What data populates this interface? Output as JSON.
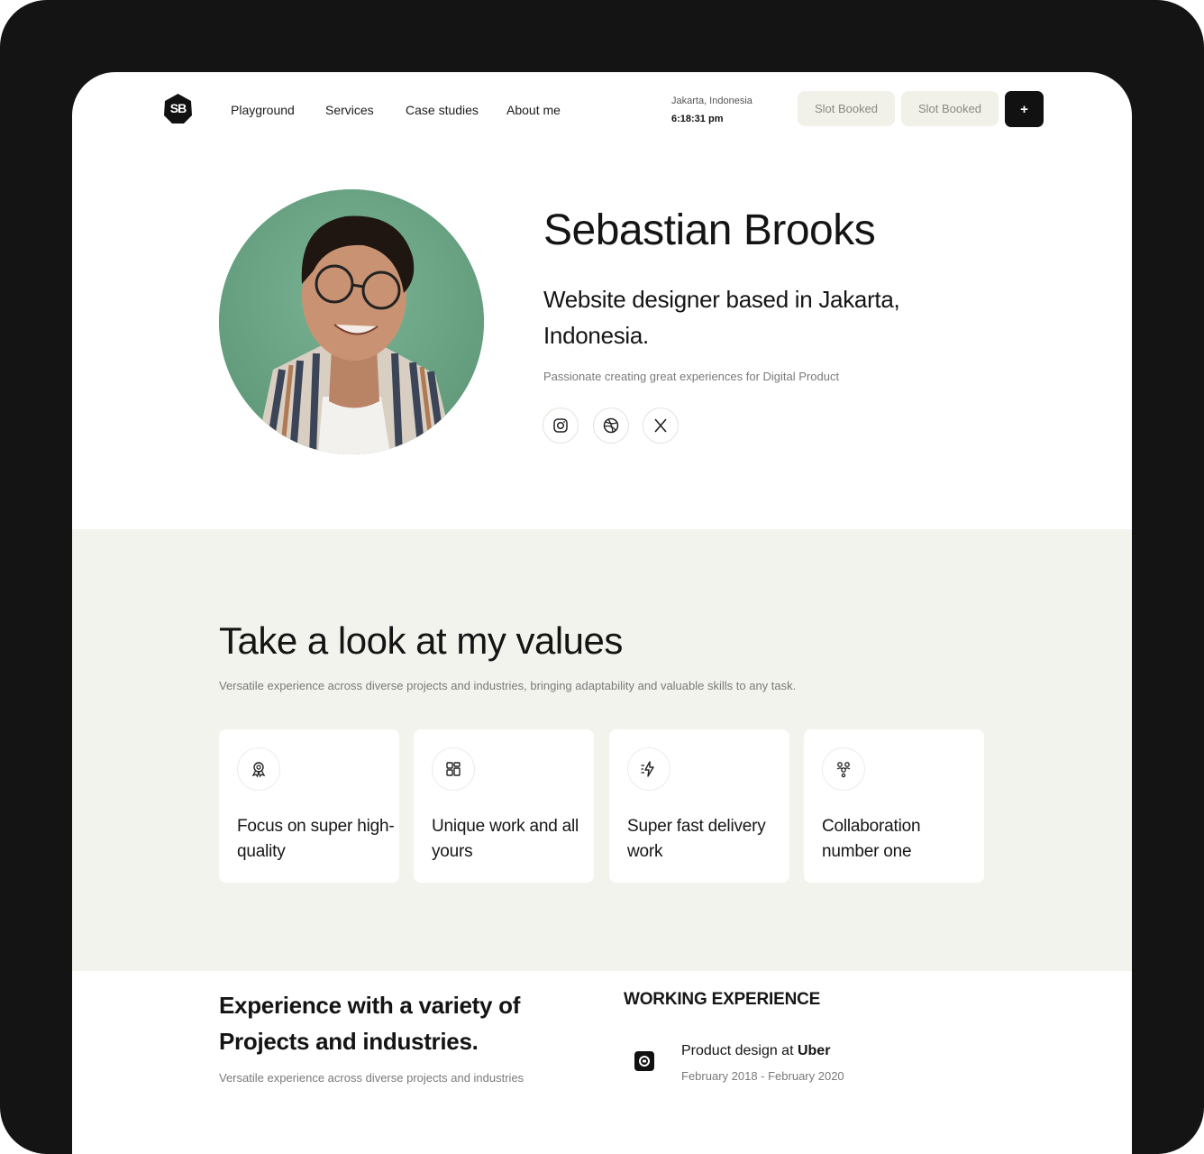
{
  "nav": {
    "logo_text": "SB",
    "links": [
      "Playground",
      "Services",
      "Case studies",
      "About me"
    ],
    "location": "Jakarta, Indonesia",
    "time": "6:18:31 pm",
    "slot_1": "Slot Booked",
    "slot_2": "Slot Booked",
    "plus_label": "+"
  },
  "hero": {
    "name": "Sebastian Brooks",
    "tagline": "Website designer based in Jakarta, Indonesia.",
    "subtitle": "Passionate creating great experiences for Digital Product",
    "socials": [
      "instagram-icon",
      "dribbble-icon",
      "x-icon"
    ]
  },
  "values": {
    "title": "Take a look at my values",
    "subtitle": "Versatile experience across diverse projects and industries, bringing adaptability and valuable skills to any task.",
    "cards": [
      {
        "icon": "award-icon",
        "text": "Focus on super high-quality"
      },
      {
        "icon": "grid-icon",
        "text": "Unique work and all yours"
      },
      {
        "icon": "lightning-icon",
        "text": "Super fast delivery work"
      },
      {
        "icon": "team-icon",
        "text": "Collaboration number one"
      }
    ]
  },
  "experience": {
    "title": "Experience with a variety of Projects and industries.",
    "subtitle": "Versatile experience across diverse projects and industries",
    "working_heading": "WORKING EXPERIENCE",
    "jobs": [
      {
        "role": "Product design at ",
        "company": "Uber",
        "dates": "February 2018 - February 2020"
      }
    ]
  }
}
